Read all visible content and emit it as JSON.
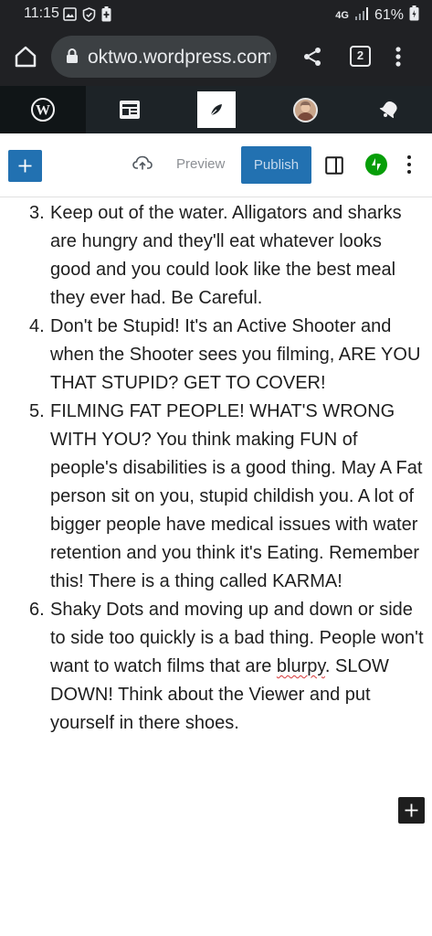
{
  "status_bar": {
    "time": "11:15",
    "network": "4G",
    "battery": "61%",
    "icons": [
      "gallery-icon",
      "shield-icon",
      "battery-saver-icon",
      "signal-icon",
      "battery-icon"
    ]
  },
  "browser": {
    "url": "oktwo.wordpress.com",
    "tab_count": "2",
    "icons": [
      "home-icon",
      "lock-icon",
      "share-icon",
      "more-vertical-icon"
    ]
  },
  "wp_toolbar": {
    "icons": [
      "wordpress-logo-icon",
      "reader-icon",
      "write-icon",
      "avatar",
      "notifications-icon"
    ]
  },
  "editor_toolbar": {
    "add_block_label": "+",
    "preview_label": "Preview",
    "publish_label": "Publish",
    "icons": [
      "cloud-upload-icon",
      "settings-sidebar-icon",
      "jetpack-icon",
      "options-icon"
    ],
    "accent_color": "#2271b1"
  },
  "content": {
    "items": [
      {
        "number": "3.",
        "text": "Keep out of the water.  Alligators and sharks are hungry and they'll eat whatever looks good and you could look like the best meal they ever had. Be Careful."
      },
      {
        "number": "4.",
        "text": "Don't be Stupid!  It's an Active Shooter and when the Shooter sees you filming, ARE YOU THAT STUPID?  GET TO COVER!"
      },
      {
        "number": "5.",
        "text": " FILMING FAT PEOPLE!  WHAT'S WRONG WITH YOU?  You think making FUN of people's disabilities is a good thing.  May A Fat person sit on you, stupid childish you. A lot of bigger people have medical issues with water retention and you think it's Eating. Remember this!  There is a thing called KARMA!"
      },
      {
        "number": "6.",
        "text_before": "Shaky Dots and moving up and down or side to side too quickly is a bad thing.  People won't want to watch films that are ",
        "misspelled": "blurpy",
        "text_after": ". SLOW DOWN!  Think about the Viewer and put yourself in there shoes."
      }
    ]
  },
  "floating_add_label": "+"
}
